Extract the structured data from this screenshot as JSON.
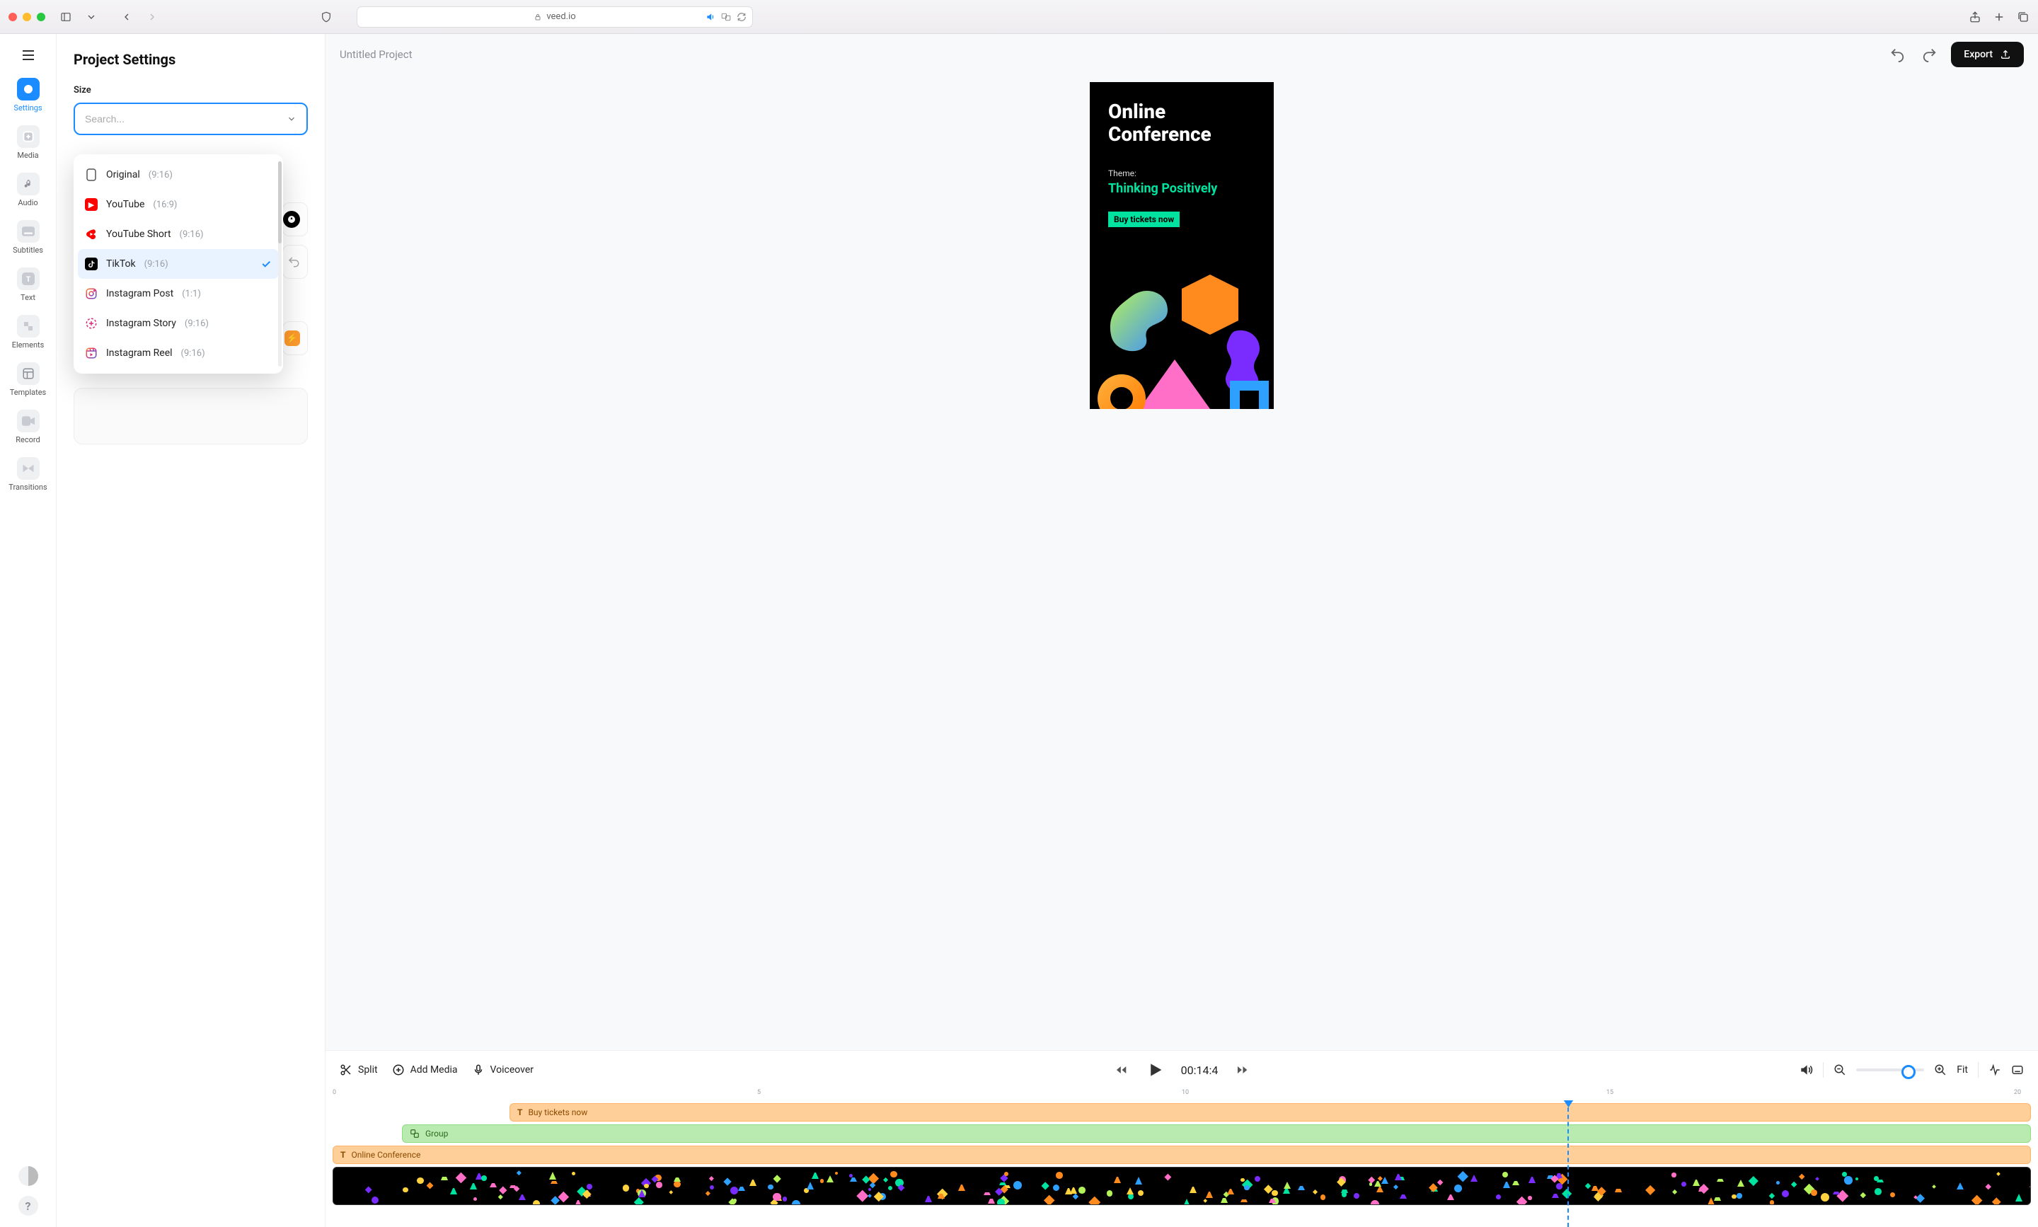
{
  "browser": {
    "url_host": "veed.io"
  },
  "sidebar": {
    "items": [
      {
        "label": "Settings"
      },
      {
        "label": "Media"
      },
      {
        "label": "Audio"
      },
      {
        "label": "Subtitles"
      },
      {
        "label": "Text"
      },
      {
        "label": "Elements"
      },
      {
        "label": "Templates"
      },
      {
        "label": "Record"
      },
      {
        "label": "Transitions"
      }
    ]
  },
  "panel": {
    "title": "Project Settings",
    "size_label": "Size",
    "search_placeholder": "Search..."
  },
  "size_options": [
    {
      "label": "Original",
      "ratio": "(9:16)",
      "icon": "original"
    },
    {
      "label": "YouTube",
      "ratio": "(16:9)",
      "icon": "youtube"
    },
    {
      "label": "YouTube Short",
      "ratio": "(9:16)",
      "icon": "ytshort"
    },
    {
      "label": "TikTok",
      "ratio": "(9:16)",
      "icon": "tiktok",
      "selected": true
    },
    {
      "label": "Instagram Post",
      "ratio": "(1:1)",
      "icon": "igpost"
    },
    {
      "label": "Instagram Story",
      "ratio": "(9:16)",
      "icon": "igstory"
    },
    {
      "label": "Instagram Reel",
      "ratio": "(9:16)",
      "icon": "igreel"
    }
  ],
  "header": {
    "project_title": "Untitled Project",
    "export_label": "Export"
  },
  "canvas": {
    "title_line1": "Online",
    "title_line2": "Conference",
    "theme_label": "Theme:",
    "theme_text": "Thinking Positively",
    "cta": "Buy tickets now"
  },
  "timeline": {
    "tools": {
      "split": "Split",
      "add_media": "Add Media",
      "voiceover": "Voiceover"
    },
    "timecode": "00:14:4",
    "fit_label": "Fit",
    "ruler": [
      "0",
      "5",
      "10",
      "15",
      "20"
    ],
    "playhead_percent": 72.5,
    "tracks": [
      {
        "type": "text",
        "label": "Buy tickets now"
      },
      {
        "type": "group",
        "label": "Group"
      },
      {
        "type": "text",
        "label": "Online Conference"
      }
    ]
  }
}
